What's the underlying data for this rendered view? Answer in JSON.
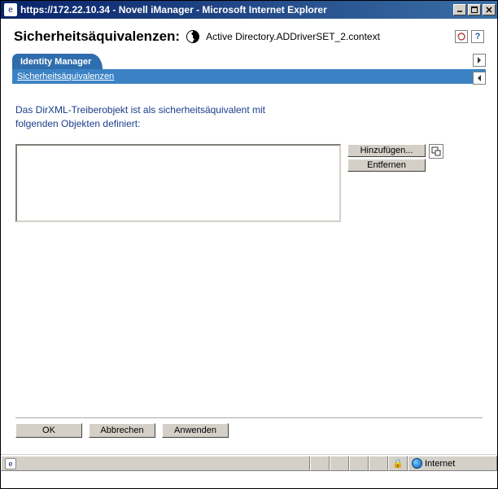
{
  "window": {
    "title": "https://172.22.10.34 - Novell iManager - Microsoft Internet Explorer"
  },
  "header": {
    "title": "Sicherheitsäquivalenzen:",
    "context": "Active Directory.ADDriverSET_2.context"
  },
  "tabs": {
    "active": "Identity Manager"
  },
  "subheader": "Sicherheitsäquivalenzen",
  "description_line1": "Das DirXML-Treiberobjekt ist als sicherheitsäquivalent mit",
  "description_line2": "folgenden Objekten definiert:",
  "buttons": {
    "add": "Hinzufügen...",
    "remove": "Entfernen",
    "ok": "OK",
    "cancel": "Abbrechen",
    "apply": "Anwenden"
  },
  "statusbar": {
    "zone": "Internet"
  }
}
